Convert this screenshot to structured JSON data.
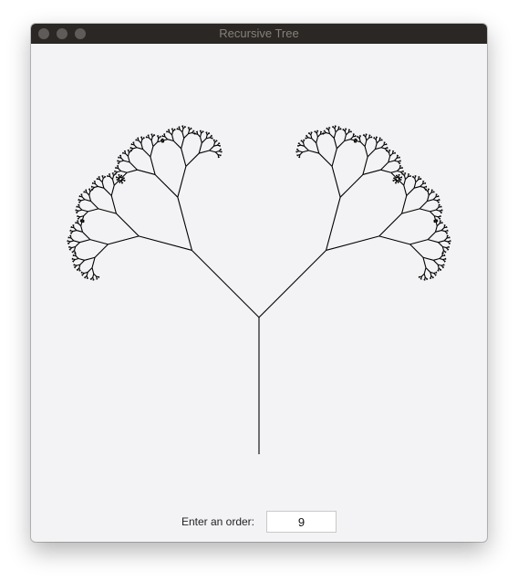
{
  "window": {
    "title": "Recursive Tree",
    "traffic_lights": [
      "close-button",
      "minimize-button",
      "zoom-button"
    ]
  },
  "tree": {
    "order": 9
  },
  "controls": {
    "prompt_label": "Enter an order:",
    "order_value": "9"
  },
  "colors": {
    "titlebar": "#2b2724",
    "title_text": "#86807a",
    "content_bg": "#f3f3f5",
    "tree_line": "#000000"
  }
}
